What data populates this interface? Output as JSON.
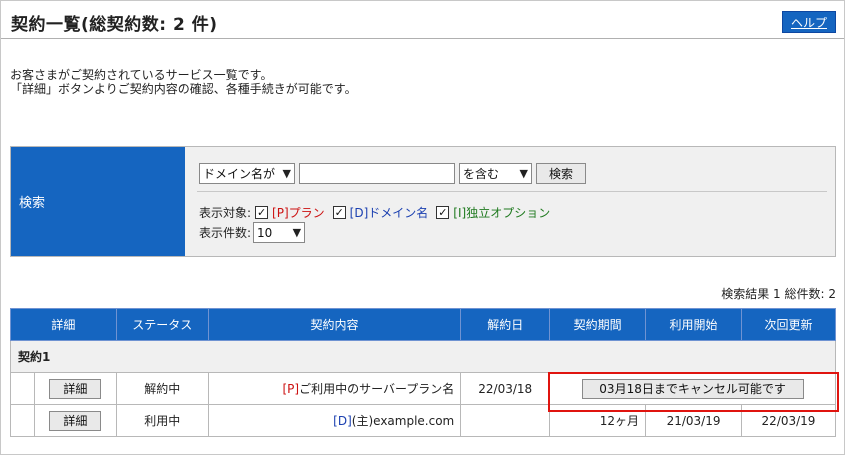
{
  "header": {
    "title": "契約一覧(総契約数: 2 件)",
    "help_label": "ヘルプ"
  },
  "intro": {
    "line1": "お客さまがご契約されているサービス一覧です。",
    "line2": "「詳細」ボタンよりご契約内容の確認、各種手続きが可能です。"
  },
  "search": {
    "label": "検索",
    "field_select": "ドメイン名が",
    "query_value": "",
    "match_select": "を含む",
    "button_label": "検索",
    "target_label": "表示対象:",
    "targets": [
      {
        "prefix": "[P]",
        "label": "プラン",
        "checked": true,
        "color": "#cc1111"
      },
      {
        "prefix": "[D]",
        "label": "ドメイン名",
        "checked": true,
        "color": "#1a3fb0"
      },
      {
        "prefix": "[I]",
        "label": "独立オプション",
        "checked": true,
        "color": "#1f7a1f"
      }
    ],
    "count_label": "表示件数:",
    "count_value": "10"
  },
  "result_summary": "検索結果 1 総件数: 2",
  "table": {
    "headers": [
      "詳細",
      "ステータス",
      "契約内容",
      "解約日",
      "契約期間",
      "利用開始",
      "次回更新"
    ],
    "group_label": "契約1",
    "rows": [
      {
        "detail_label": "詳細",
        "status": "解約中",
        "content_prefix": "[P]",
        "content_text": "ご利用中のサーバープラン名",
        "cancel_date": "22/03/18",
        "cancel_notice": "03月18日までキャンセル可能です"
      },
      {
        "detail_label": "詳細",
        "status": "利用中",
        "content_prefix": "[D]",
        "content_text": "(主)example.com",
        "cancel_date": "",
        "period": "12ヶ月",
        "start": "21/03/19",
        "renewal": "22/03/19"
      }
    ]
  },
  "colors": {
    "accent": "#1565c0",
    "highlight": "#e0140f"
  }
}
